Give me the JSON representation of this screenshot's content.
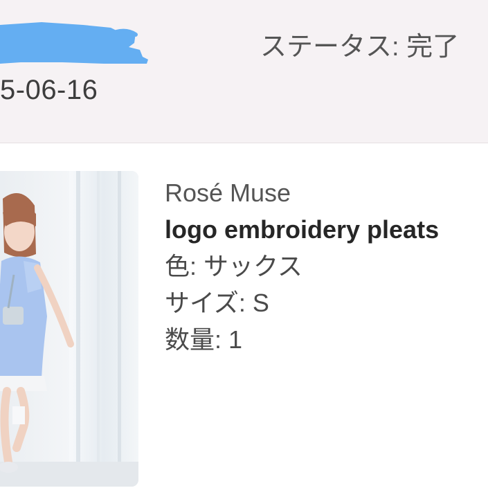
{
  "order": {
    "date_fragment": "5-06-16",
    "status_label": "ステータス: 完了"
  },
  "item": {
    "brand": "Rosé Muse",
    "title": "logo embroidery pleats",
    "color_line": "色: サックス",
    "size_line": "サイズ: S",
    "quantity_line": "数量: 1"
  },
  "colors": {
    "header_background": "#f6f2f4",
    "redaction_marker": "#64aef2",
    "text_dark": "#262626"
  }
}
